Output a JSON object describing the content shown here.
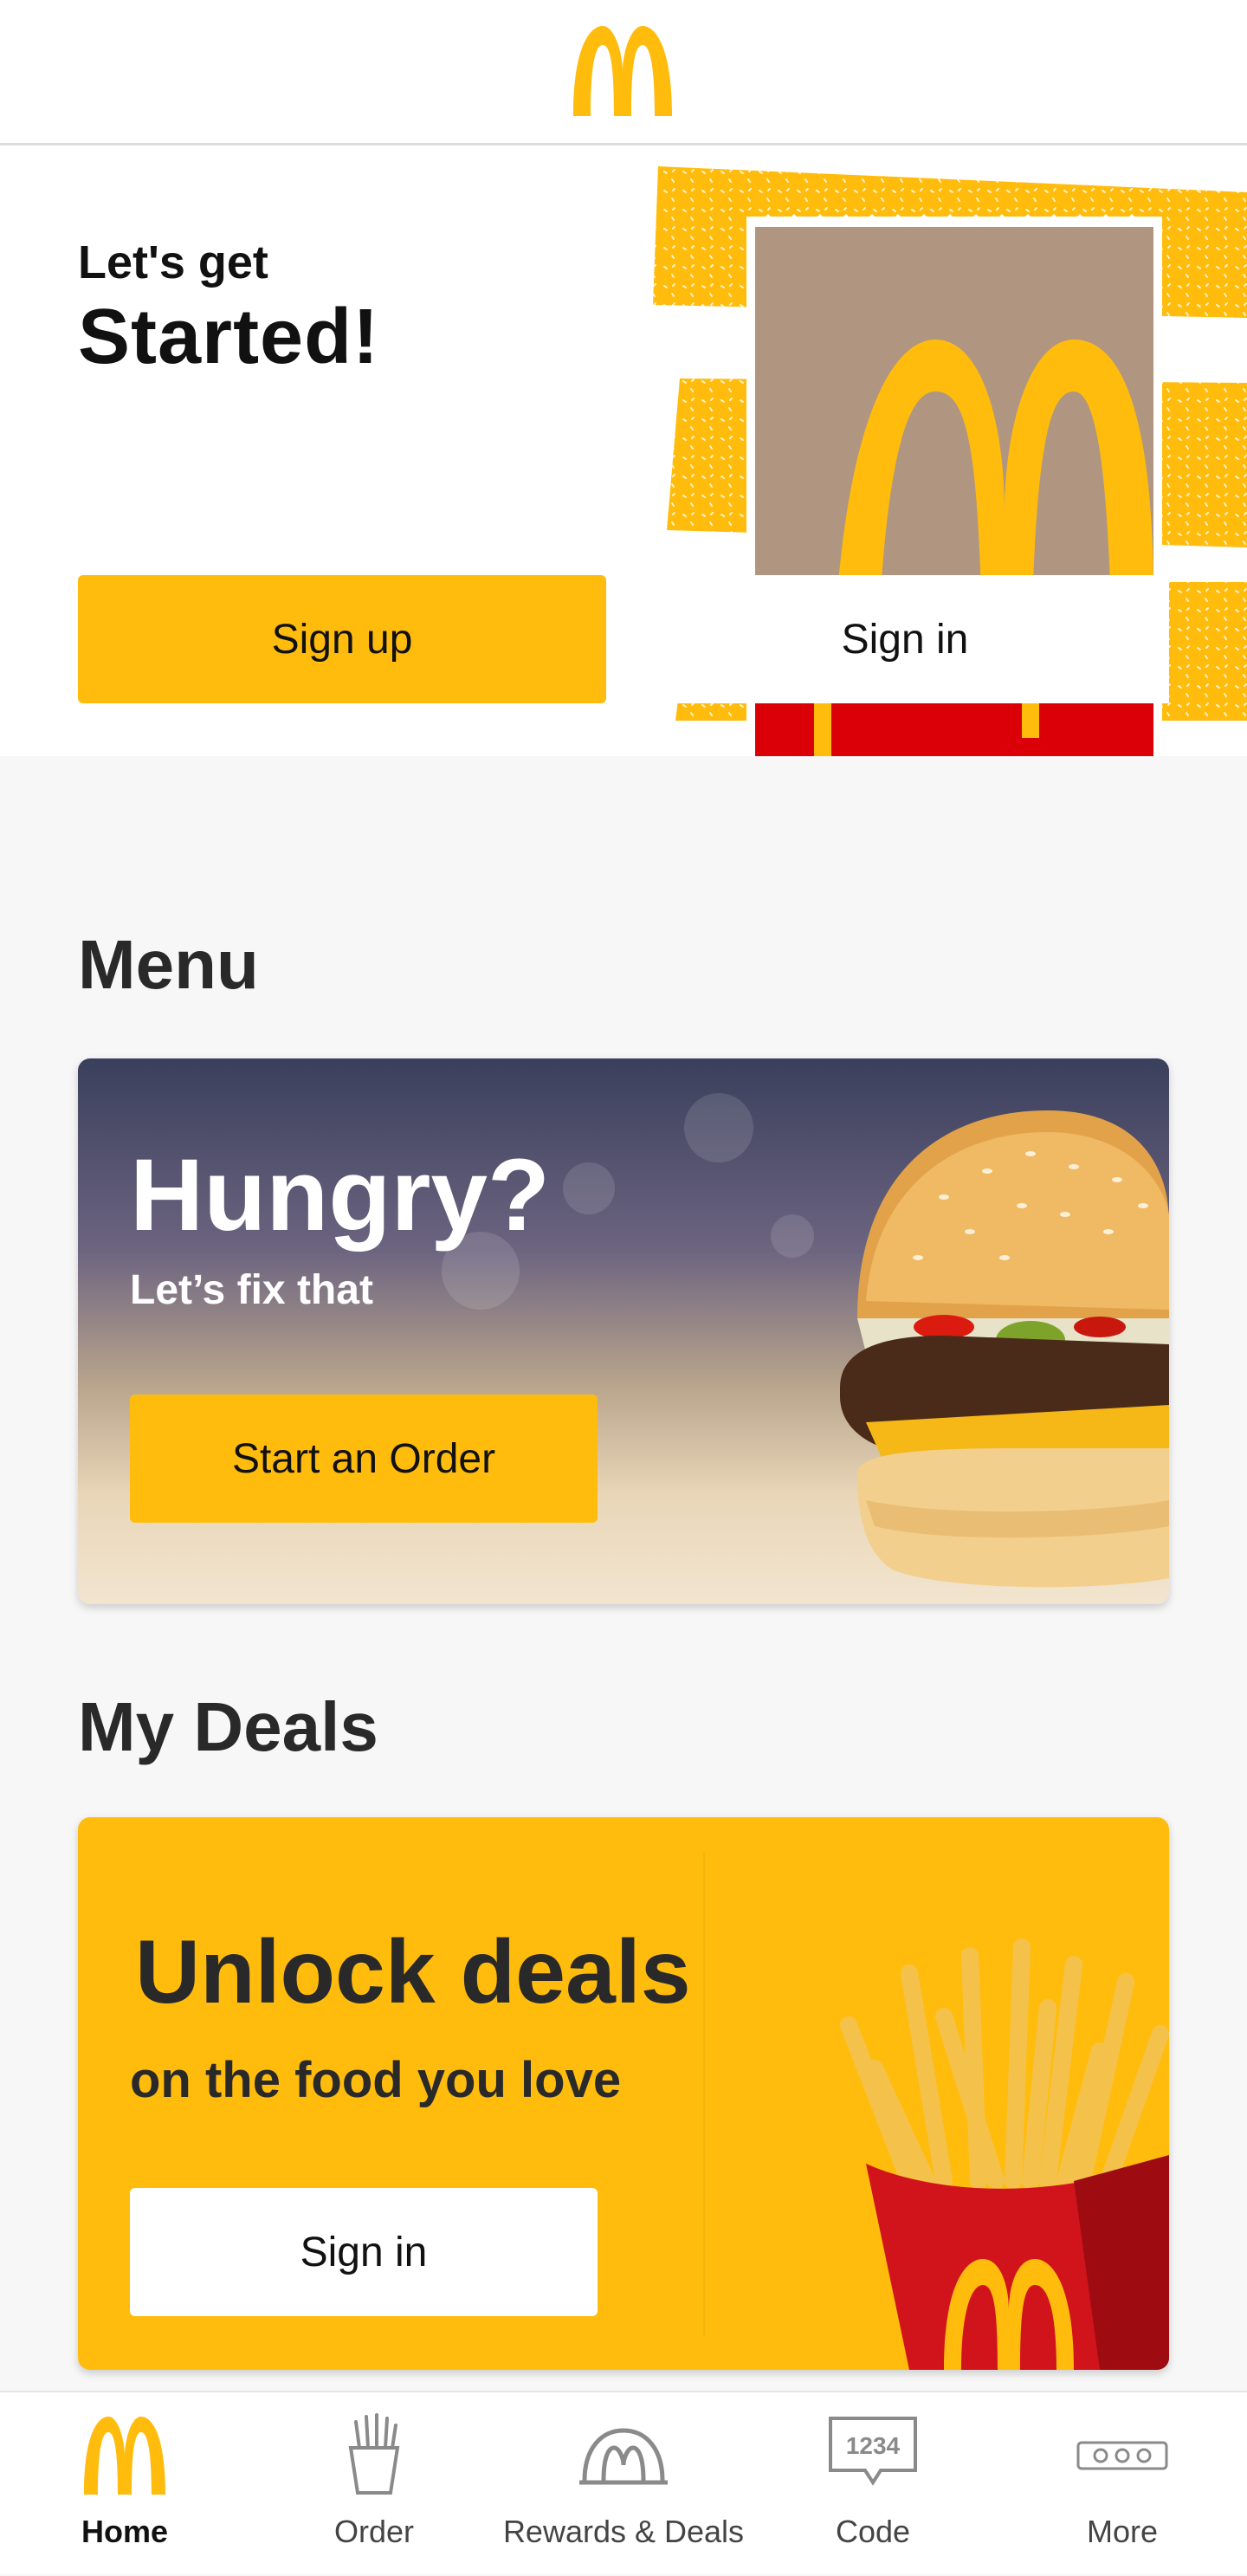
{
  "hero": {
    "line1": "Let's get",
    "line2": "Started!",
    "signup_label": "Sign up",
    "signin_label": "Sign in"
  },
  "menu": {
    "heading": "Menu",
    "card_title": "Hungry?",
    "card_subtitle": "Let’s fix that",
    "cta_label": "Start an Order"
  },
  "deals": {
    "heading": "My Deals",
    "card_title": "Unlock deals",
    "card_subtitle": "on the food you love",
    "cta_label": "Sign in"
  },
  "tabs": [
    {
      "label": "Home",
      "icon": "arches-icon",
      "active": true
    },
    {
      "label": "Order",
      "icon": "fries-icon",
      "active": false
    },
    {
      "label": "Rewards & Deals",
      "icon": "rewards-icon",
      "active": false
    },
    {
      "label": "Code",
      "icon": "code-icon",
      "active": false
    },
    {
      "label": "More",
      "icon": "more-icon",
      "active": false
    }
  ],
  "code_icon_text": "1234",
  "colors": {
    "brand_yellow": "#ffbc0d",
    "brand_red": "#db0007",
    "text_dark": "#292929"
  }
}
